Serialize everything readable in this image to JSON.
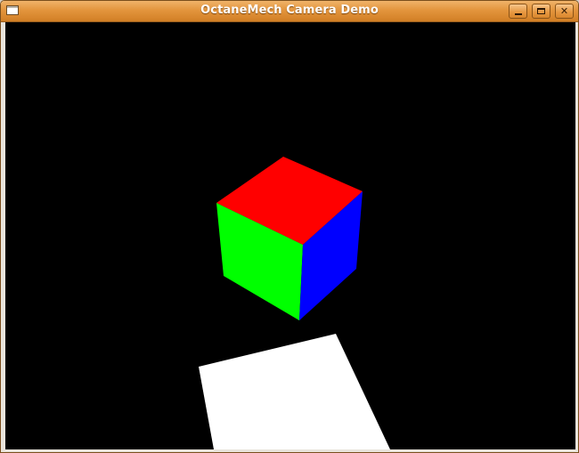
{
  "window": {
    "title": "OctaneMech Camera Demo",
    "controls": {
      "minimize_icon": "minimize-icon",
      "maximize_icon": "maximize-icon",
      "close_icon": "close-icon",
      "close_glyph": "✕"
    }
  },
  "scene": {
    "background_color": "#000000",
    "cube": {
      "top_face_color": "#ff0000",
      "left_face_color": "#00ff00",
      "right_face_color": "#0000ff"
    },
    "floor": {
      "color": "#ffffff"
    }
  },
  "colors": {
    "titlebar_accent": "#e3953d"
  }
}
